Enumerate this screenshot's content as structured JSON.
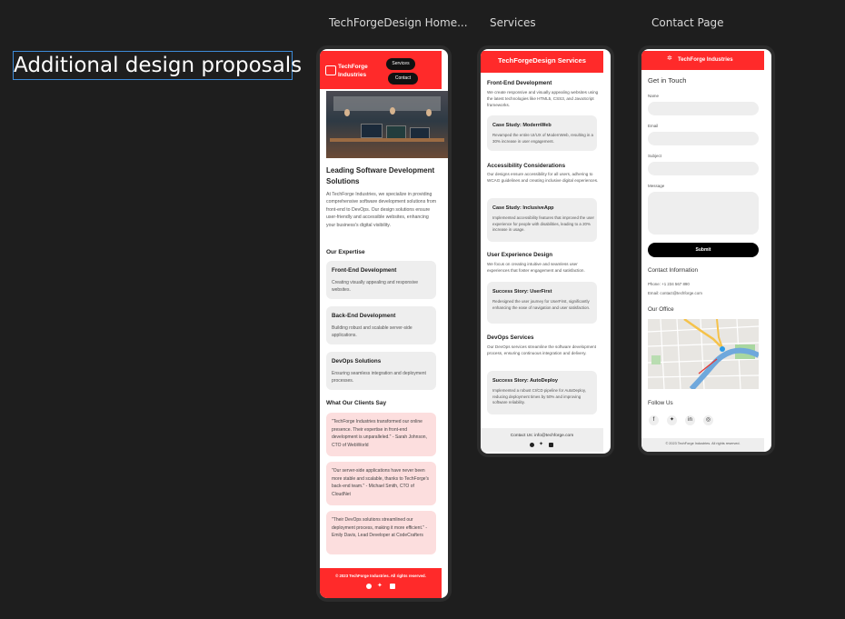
{
  "canvas": {
    "title": "Additional design proposals"
  },
  "frames": {
    "home": "TechForgeDesign Home...",
    "services": "Services",
    "contact": "Contact Page"
  },
  "home": {
    "brand": "TechForge Industries",
    "nav": {
      "services": "Services",
      "contact": "Contact"
    },
    "hero_title": "Leading Software Development Solutions",
    "hero_text": "At TechForge Industries, we specialize in providing comprehensive software development solutions from front-end to DevOps. Our design solutions ensure user-friendly and accessible websites, enhancing your business's digital visibility.",
    "expertise_heading": "Our Expertise",
    "expertise": [
      {
        "title": "Front-End Development",
        "text": "Creating visually appealing and responsive websites."
      },
      {
        "title": "Back-End Development",
        "text": "Building robust and scalable server-side applications."
      },
      {
        "title": "DevOps Solutions",
        "text": "Ensuring seamless integration and deployment processes."
      }
    ],
    "clients_heading": "What Our Clients Say",
    "testimonials": [
      "\"TechForge Industries transformed our online presence. Their expertise in front-end development is unparalleled.\" - Sarah Johnson, CTO of WebWorld",
      "\"Our server-side applications have never been more stable and scalable, thanks to TechForge's back-end team.\" - Michael Smith, CTO of CloudNet",
      "\"Their DevOps solutions streamlined our deployment process, making it more efficient.\" - Emily Davis, Lead Developer at CodeCrafters"
    ],
    "footer": "© 2023 TechForge Industries. All rights reserved."
  },
  "services": {
    "header": "TechForgeDesign Services",
    "sections": [
      {
        "title": "Front-End Development",
        "text": "We create responsive and visually appealing websites using the latest technologies like HTML5, CSS3, and JavaScript frameworks.",
        "card_title": "Case Study: ModernWeb",
        "card_text": "Revamped the entire UI/UX of ModernWeb, resulting in a 30% increase in user engagement."
      },
      {
        "title": "Accessibility Considerations",
        "text": "Our designs ensure accessibility for all users, adhering to WCAG guidelines and creating inclusive digital experiences.",
        "card_title": "Case Study: InclusiveApp",
        "card_text": "Implemented accessibility features that improved the user experience for people with disabilities, leading to a 20% increase in usage."
      },
      {
        "title": "User Experience Design",
        "text": "We focus on creating intuitive and seamless user experiences that foster engagement and satisfaction.",
        "card_title": "Success Story: UserFirst",
        "card_text": "Redesigned the user journey for UserFirst, significantly enhancing the ease of navigation and user satisfaction."
      },
      {
        "title": "DevOps Services",
        "text": "Our DevOps services streamline the software development process, ensuring continuous integration and delivery.",
        "card_title": "Success Story: AutoDeploy",
        "card_text": "Implemented a robust CI/CD pipeline for AutoDeploy, reducing deployment times by 50% and improving software reliability."
      }
    ],
    "footer_contact": "Contact Us: info@techforge.com"
  },
  "contact": {
    "brand": "TechForge Industries",
    "heading": "Get in Touch",
    "fields": {
      "name": "Name",
      "email": "Email",
      "subject": "Subject",
      "message": "Message"
    },
    "submit": "Submit",
    "info_heading": "Contact Information",
    "phone": "Phone: +1 234 567 890",
    "email": "Email: contact@techforge.com",
    "office_heading": "Our Office",
    "follow_heading": "Follow Us",
    "footer": "© 2023 TechForge Industries. All rights reserved."
  },
  "colors": {
    "accent": "#ff2a2a",
    "background": "#1e1e1e",
    "card": "#eeeeee",
    "testimonial": "#fcdede"
  },
  "icons": [
    "facebook-icon",
    "twitter-icon",
    "linkedin-icon",
    "instagram-icon",
    "email-icon",
    "logo-icon"
  ]
}
